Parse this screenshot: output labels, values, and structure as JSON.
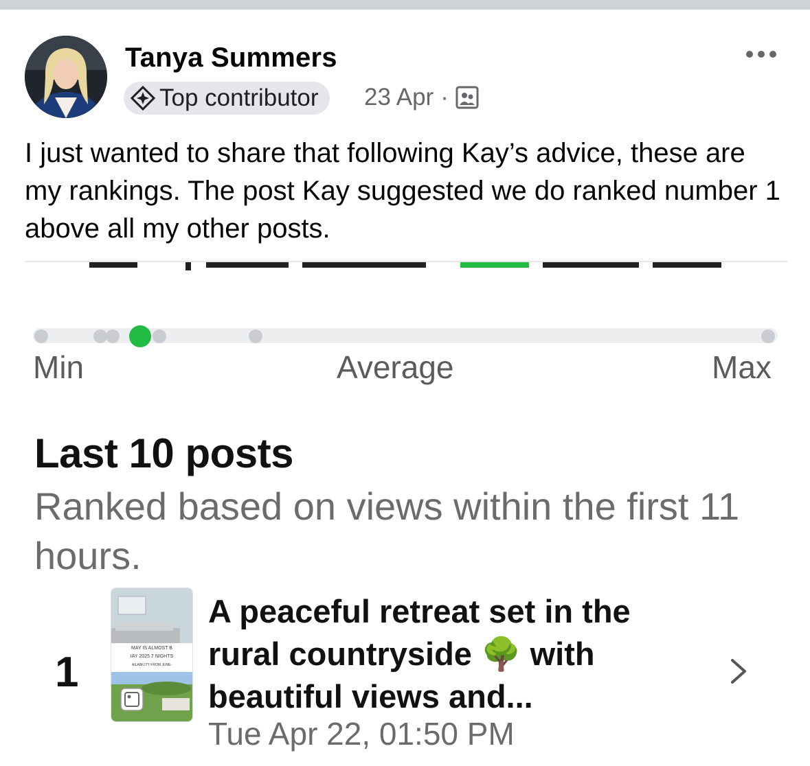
{
  "post": {
    "author": "Tanya Summers",
    "badge": "Top contributor",
    "date": "23 Apr",
    "separator": "·",
    "audience_icon": "group-icon",
    "more_icon": "more-options-icon",
    "text": "I just wanted to share that following Kay’s advice, these are my rankings. The post Kay suggested we do ranked number 1 above all my other posts."
  },
  "screenshot": {
    "scale": {
      "min": "Min",
      "average": "Average",
      "max": "Max"
    },
    "section_title": "Last 10 posts",
    "section_subtitle": "Ranked based on views within the first 11 hours.",
    "items": [
      {
        "rank": "1",
        "title": "A peaceful retreat set in the rural countryside 🌳 with beautiful views and...",
        "date": "Tue Apr 22, 01:50 PM",
        "thumb_lines": [
          "MAY IS ALMOST B",
          "IAY 2025 7 NIGHTS",
          "AILABILITY FROM JUNE-"
        ]
      }
    ],
    "accent_color": "#22bb44"
  }
}
